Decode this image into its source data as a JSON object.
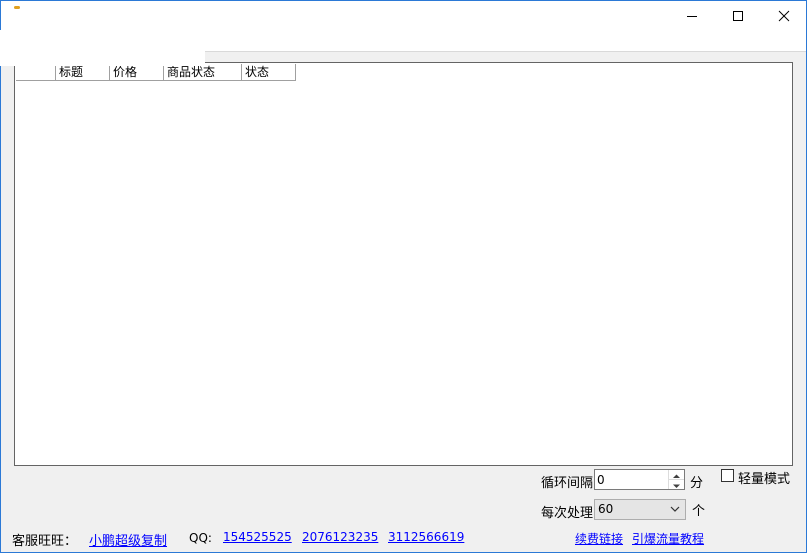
{
  "window": {
    "controls": {
      "minimize": "minimize-icon",
      "maximize": "maximize-icon",
      "close": "close-icon"
    }
  },
  "table": {
    "columns": [
      "",
      "标题",
      "价格",
      "商品状态",
      "状态"
    ]
  },
  "controls": {
    "interval_label": "循环间隔",
    "interval_value": "0",
    "interval_unit": "分",
    "lite_mode_label": "轻量模式",
    "batch_label": "每次处理",
    "batch_value": "60",
    "batch_unit": "个"
  },
  "footer": {
    "wangwang_label": "客服旺旺：",
    "wangwang_link": "小鹏超级复制",
    "qq_label": "QQ:",
    "qq_links": [
      "154525525",
      "2076123235",
      "3112566619"
    ],
    "renew_link": "续费链接",
    "traffic_link": "引爆流量教程"
  }
}
